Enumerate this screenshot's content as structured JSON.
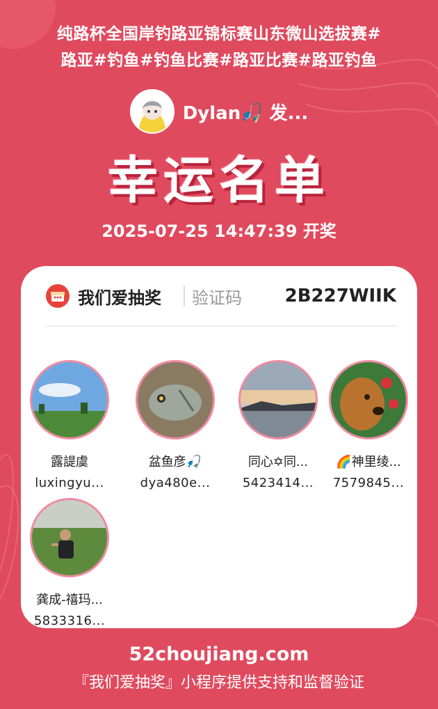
{
  "header": {
    "title_line1": "纯路杯全国岸钓路亚锦标赛山东微山选拔赛#",
    "title_line2": "路亚#钓鱼#钓鱼比赛#路亚比赛#路亚钓鱼"
  },
  "host": {
    "name": "Dylan🎣 发..."
  },
  "banner": "幸运名单",
  "draw_time": "2025-07-25 14:47:39 开奖",
  "card": {
    "brand": "我们爱抽奖",
    "verify_label": "验证码",
    "verify_code": "2B227WIIK",
    "winners": [
      {
        "name": "露諟虞",
        "id": "luxingyu..."
      },
      {
        "name": "盆鱼彦🎣",
        "id": "dya480e..."
      },
      {
        "name": "同心✡同...",
        "id": "5423414..."
      },
      {
        "name": "🌈神里绫...",
        "id": "7579845..."
      },
      {
        "name": "龚成-禧玛...",
        "id": "5833316..."
      }
    ]
  },
  "footer": {
    "url": "52choujiang.com",
    "note": "『我们爱抽奖』小程序提供支持和监督验证"
  },
  "colors": {
    "background": "#e04a5e",
    "avatar_border": "#f08aa0",
    "gift_icon": "#e8433a"
  }
}
